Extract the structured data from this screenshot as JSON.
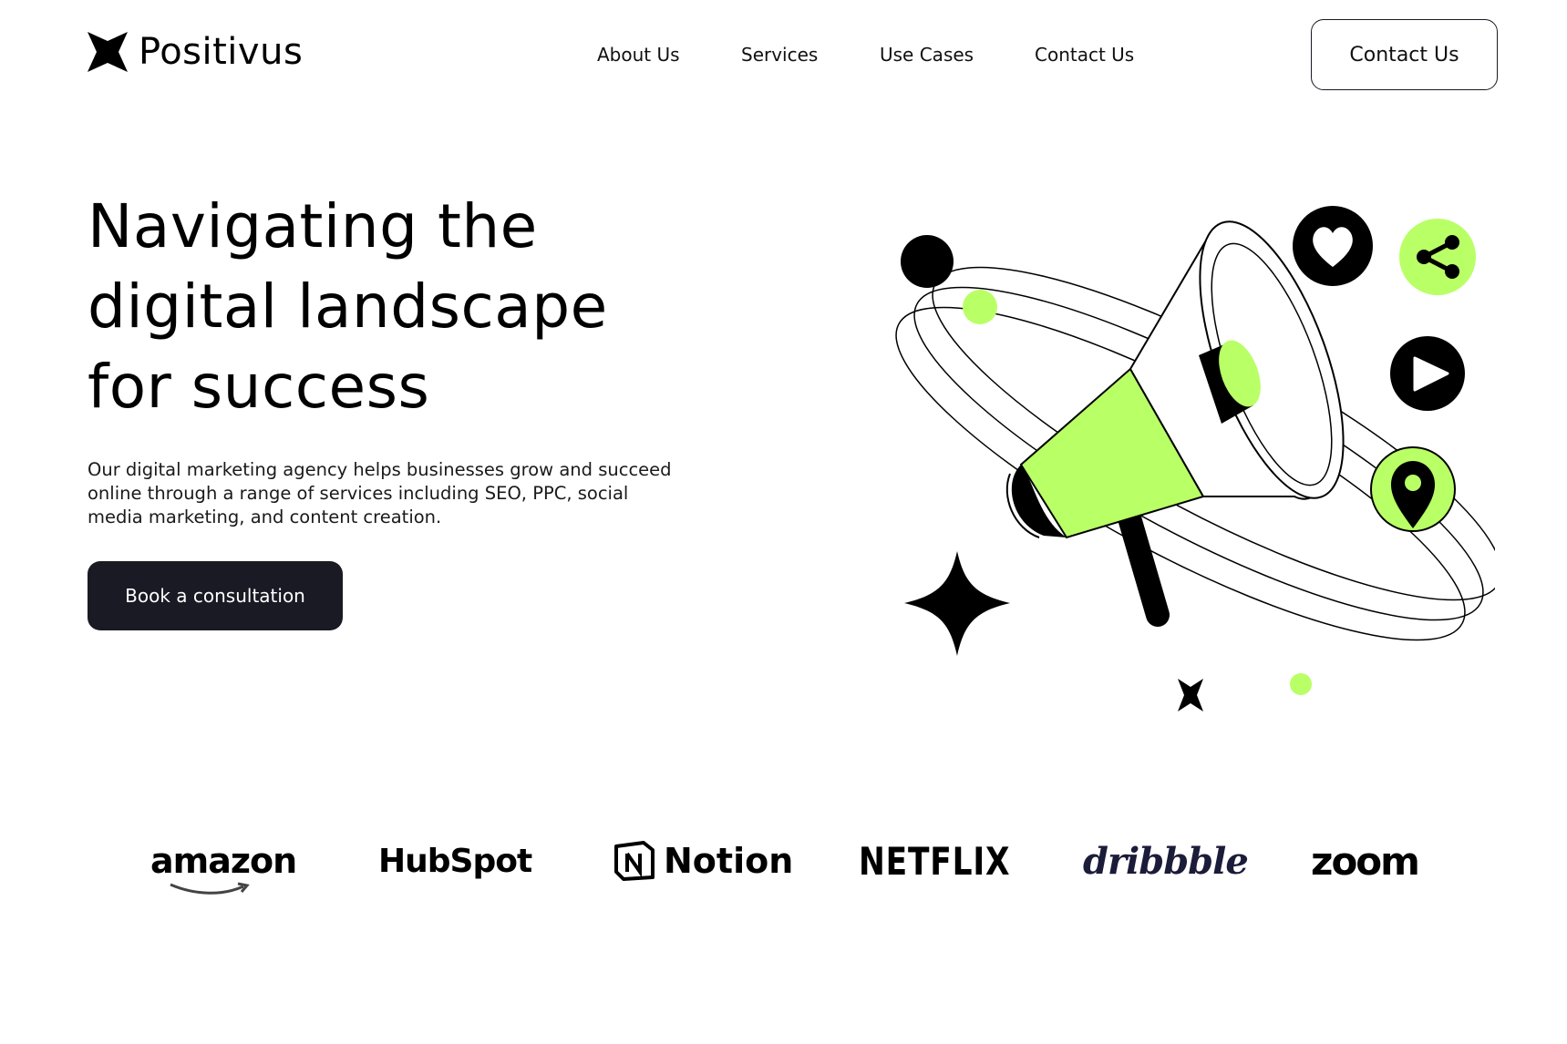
{
  "brand": {
    "name": "Positivus",
    "accent_color": "#B9FF66",
    "dark_color": "#191A23"
  },
  "nav": {
    "links": [
      "About Us",
      "Services",
      "Use Cases",
      "Contact Us"
    ]
  },
  "header": {
    "contact_button": "Contact Us"
  },
  "hero": {
    "title_lines": [
      "Navigating the",
      "digital landscape",
      "for success"
    ],
    "description": "Our digital marketing agency helps businesses grow and succeed online through a range of services including SEO, PPC, social media marketing, and content creation.",
    "cta_label": "Book a consultation",
    "illustration_icons": [
      "megaphone-icon",
      "heart-icon",
      "share-icon",
      "play-icon",
      "location-pin-icon",
      "sparkle-star-icon"
    ]
  },
  "clients": {
    "logos": [
      "amazon",
      "HubSpot",
      "Notion",
      "NETFLIX",
      "dribbble",
      "zoom"
    ]
  }
}
